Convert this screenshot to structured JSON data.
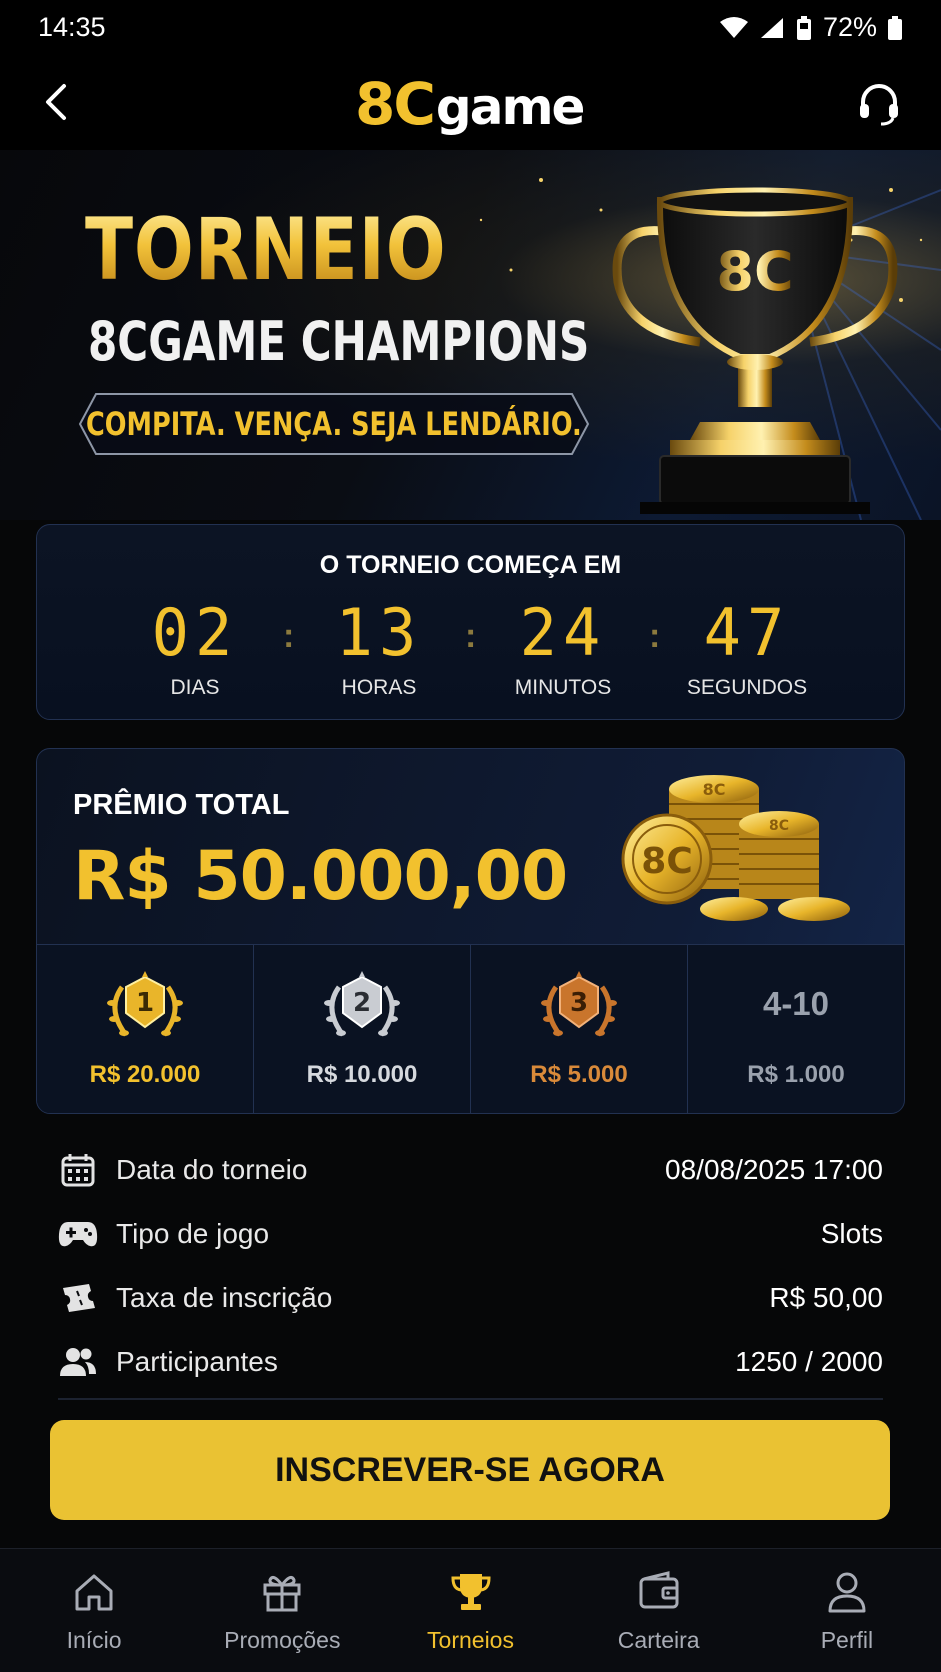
{
  "status_bar": {
    "time": "14:35",
    "battery": "72%"
  },
  "header": {
    "logo_part1": "8C",
    "logo_part2": "game",
    "back_icon": "chevron-left-icon",
    "support_icon": "headset-icon"
  },
  "hero": {
    "title": "TORNEIO",
    "subtitle": "8CGAME CHAMPIONS",
    "tagline": "COMPITA. VENÇA. SEJA LENDÁRIO.",
    "trophy_text": "8C"
  },
  "countdown": {
    "title": "O TORNEIO COMEÇA EM",
    "units": [
      {
        "value": "02",
        "label": "DIAS"
      },
      {
        "value": "13",
        "label": "HORAS"
      },
      {
        "value": "24",
        "label": "MINUTOS"
      },
      {
        "value": "47",
        "label": "SEGUNDOS"
      }
    ]
  },
  "prize": {
    "label": "PRÊMIO TOTAL",
    "amount": "R$ 50.000,00",
    "coin_text": "8C",
    "tiers": [
      {
        "rank": "1",
        "value": "R$ 20.000",
        "color": "#f2c12e"
      },
      {
        "rank": "2",
        "value": "R$ 10.000",
        "color": "#d6d9de"
      },
      {
        "rank": "3",
        "value": "R$ 5.000",
        "color": "#d98a3a"
      },
      {
        "rank": "4-10",
        "value": "R$ 1.000",
        "color": "#9aa1ad"
      }
    ]
  },
  "info": [
    {
      "icon": "calendar-icon",
      "label": "Data do torneio",
      "value": "08/08/2025 17:00"
    },
    {
      "icon": "gamepad-icon",
      "label": "Tipo de jogo",
      "value": "Slots"
    },
    {
      "icon": "ticket-icon",
      "label": "Taxa de inscrição",
      "value": "R$ 50,00"
    },
    {
      "icon": "users-icon",
      "label": "Participantes",
      "value": "1250 / 2000"
    }
  ],
  "cta_label": "INSCREVER-SE AGORA",
  "nav": [
    {
      "icon": "home-icon",
      "label": "Início",
      "active": false
    },
    {
      "icon": "gift-icon",
      "label": "Promoções",
      "active": false
    },
    {
      "icon": "trophy-icon",
      "label": "Torneios",
      "active": true
    },
    {
      "icon": "wallet-icon",
      "label": "Carteira",
      "active": false
    },
    {
      "icon": "user-icon",
      "label": "Perfil",
      "active": false
    }
  ],
  "colors": {
    "accent": "#f2c12e",
    "background": "#060708",
    "card_border": "#223151"
  }
}
